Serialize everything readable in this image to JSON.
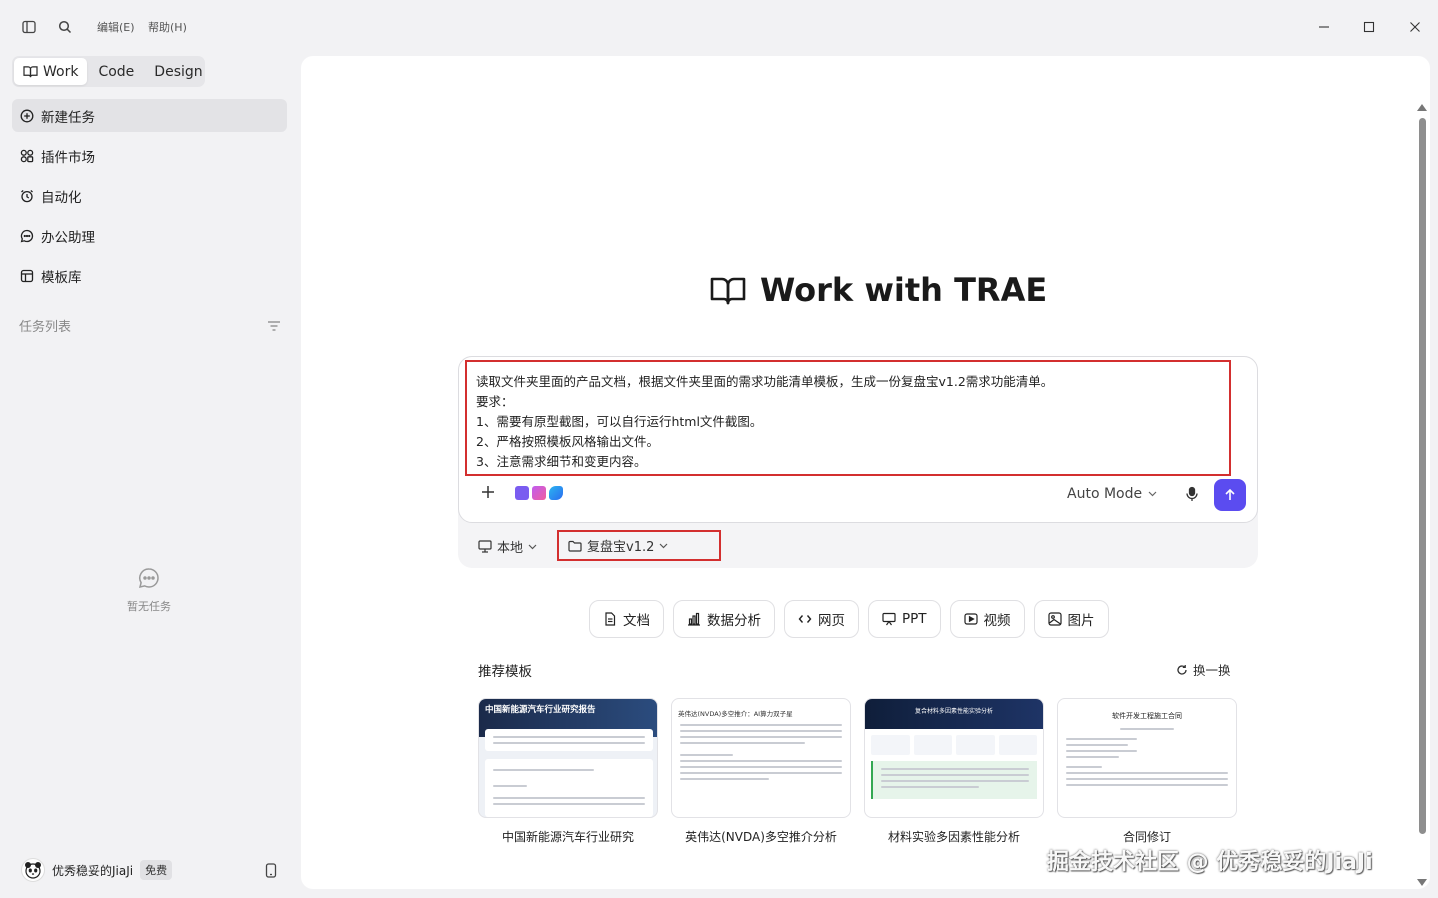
{
  "titlebar": {
    "menu_edit": "编辑(E)",
    "menu_help": "帮助(H)"
  },
  "mode_tabs": [
    {
      "label": "Work",
      "active": true
    },
    {
      "label": "Code",
      "active": false
    },
    {
      "label": "Design",
      "active": false
    }
  ],
  "sidebar": {
    "items": [
      {
        "label": "新建任务",
        "icon": "plus-circle-icon",
        "active": true
      },
      {
        "label": "插件市场",
        "icon": "grid-icon"
      },
      {
        "label": "自动化",
        "icon": "alarm-clock-icon"
      },
      {
        "label": "办公助理",
        "icon": "chat-bubble-icon"
      },
      {
        "label": "模板库",
        "icon": "template-icon"
      }
    ],
    "task_list_label": "任务列表",
    "empty_label": "暂无任务"
  },
  "user": {
    "name": "优秀稳妥的JiaJi",
    "plan": "免费"
  },
  "hero": {
    "title": "Work with TRAE"
  },
  "composer": {
    "lines": [
      "读取文件夹里面的产品文档，根据文件夹里面的需求功能清单模板，生成一份复盘宝v1.2需求功能清单。",
      "要求：",
      "1、需要有原型截图，可以自行运行html文件截图。",
      "2、严格按照模板风格输出文件。",
      "3、注意需求细节和变更内容。"
    ],
    "mode": "Auto Mode",
    "location": "本地",
    "folder": "复盘宝v1.2"
  },
  "chips": [
    {
      "label": "文档",
      "icon": "document-icon"
    },
    {
      "label": "数据分析",
      "icon": "bar-chart-icon"
    },
    {
      "label": "网页",
      "icon": "code-brackets-icon"
    },
    {
      "label": "PPT",
      "icon": "presentation-icon"
    },
    {
      "label": "视频",
      "icon": "video-icon"
    },
    {
      "label": "图片",
      "icon": "image-icon"
    }
  ],
  "recommend": {
    "title": "推荐模板",
    "refresh": "换一换",
    "cards": [
      {
        "label": "中国新能源汽车行业研究",
        "thumb_title": "中国新能源汽车行业研究报告"
      },
      {
        "label": "英伟达(NVDA)多空推介分析",
        "thumb_title": "英伟达(NVDA)多空推介：AI算力双子星"
      },
      {
        "label": "材料实验多因素性能分析",
        "thumb_title": "复合材料多因素性能实验分析"
      },
      {
        "label": "合同修订",
        "thumb_title": "软件开发工程施工合同"
      }
    ]
  },
  "watermark": "掘金技术社区 @ 优秀稳妥的JiaJi",
  "colors": {
    "accent": "#5b4cf0",
    "highlight_border": "#d32f2f"
  }
}
